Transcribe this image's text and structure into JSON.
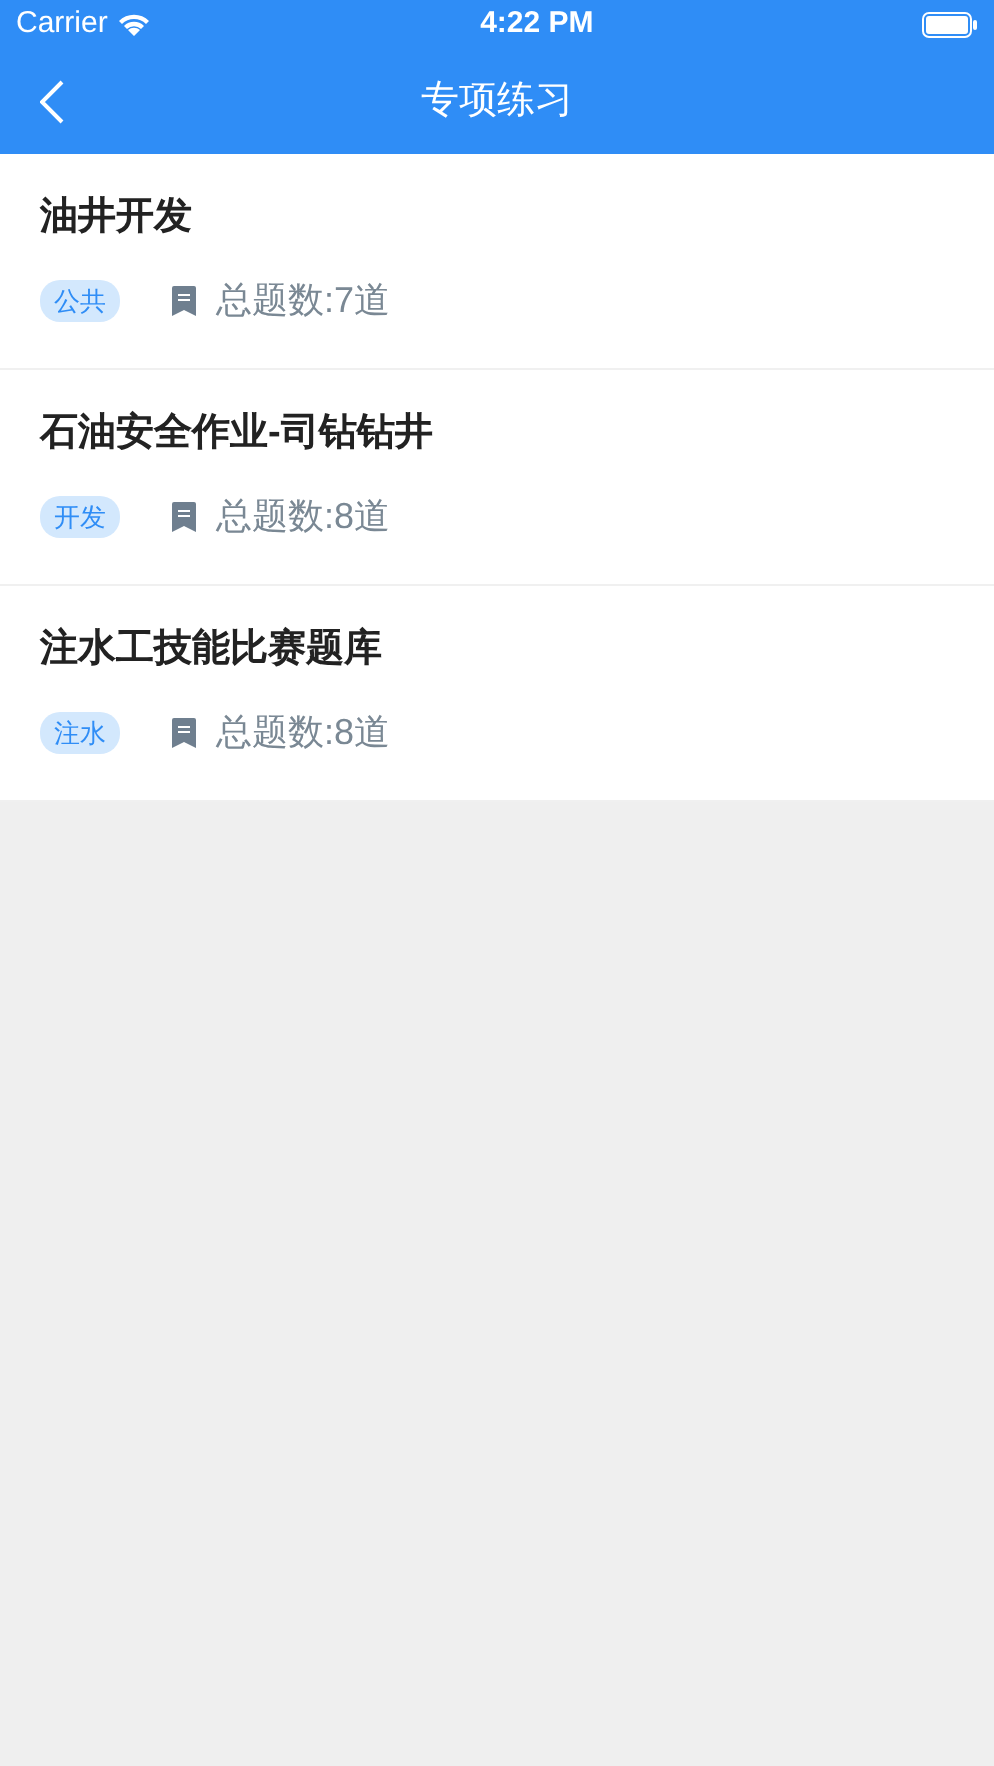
{
  "status_bar": {
    "carrier": "Carrier",
    "time": "4:22 PM"
  },
  "nav": {
    "title": "专项练习"
  },
  "items": [
    {
      "title": "油井开发",
      "tag": "公共",
      "count": "总题数:7道"
    },
    {
      "title": "石油安全作业-司钻钻井",
      "tag": "开发",
      "count": "总题数:8道"
    },
    {
      "title": "注水工技能比赛题库",
      "tag": "注水",
      "count": "总题数:8道"
    }
  ]
}
